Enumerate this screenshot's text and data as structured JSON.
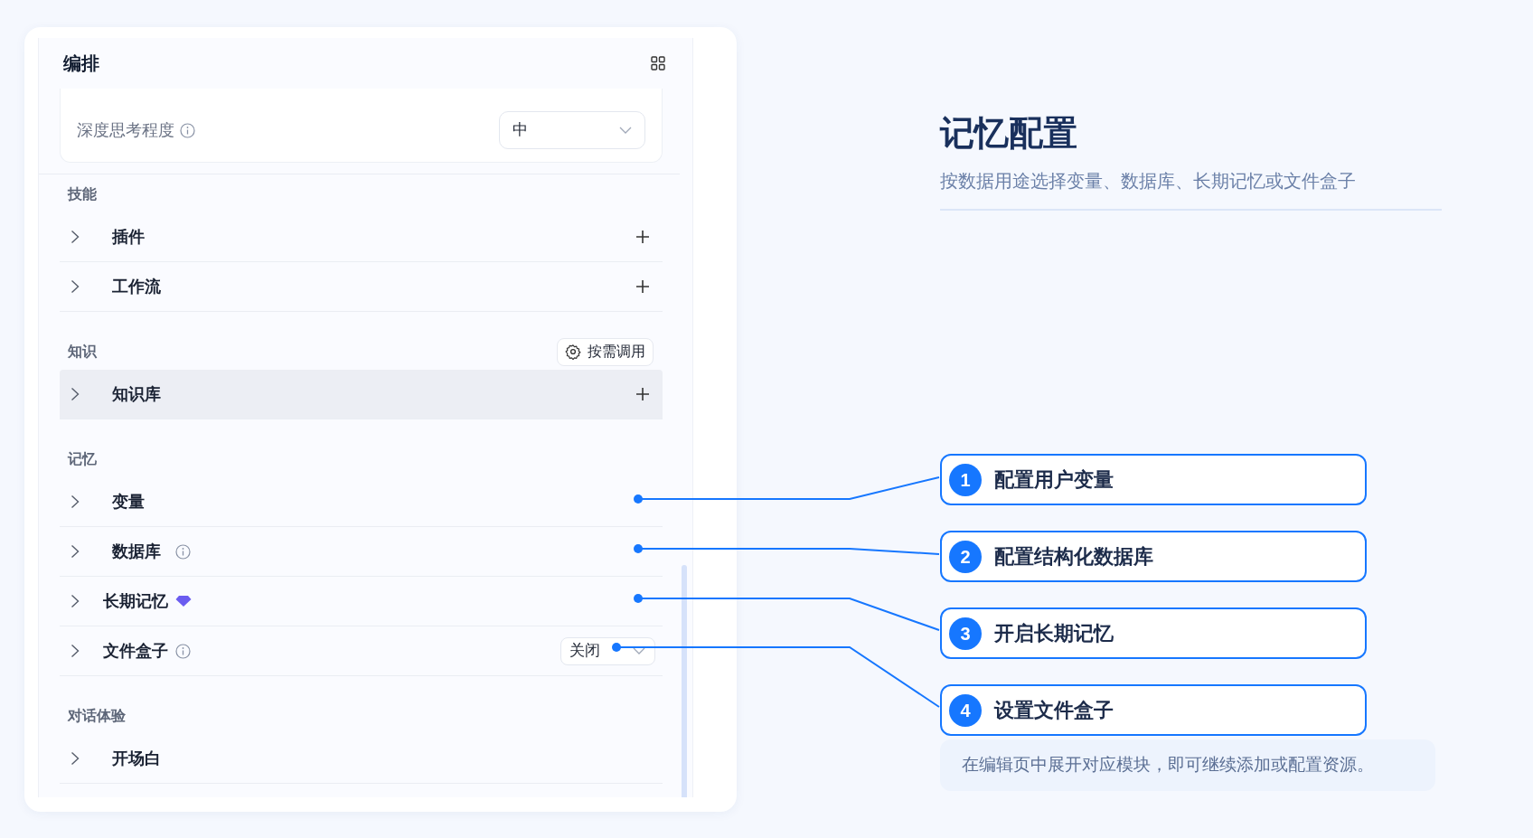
{
  "panel": {
    "title": "编排",
    "settings": [
      {
        "label": "深度思考程度",
        "info": true,
        "value": "中"
      }
    ],
    "sections": [
      {
        "heading": "技能",
        "items": [
          {
            "label": "插件",
            "kind": "add",
            "highlighted": false
          },
          {
            "label": "工作流",
            "kind": "add",
            "highlighted": false
          }
        ]
      },
      {
        "heading": "知识",
        "action": "按需调用",
        "items": [
          {
            "label": "知识库",
            "kind": "add",
            "highlighted": true
          }
        ]
      },
      {
        "heading": "记忆",
        "items": [
          {
            "label": "变量",
            "kind": "plain",
            "highlighted": false
          },
          {
            "label": "数据库",
            "kind": "plain",
            "info": true,
            "highlighted": false
          },
          {
            "label": "长期记忆",
            "kind": "plain",
            "premium": true,
            "highlighted": false
          },
          {
            "label": "文件盒子",
            "kind": "select",
            "value": "关闭",
            "info": true,
            "highlighted": false
          }
        ]
      },
      {
        "heading": "对话体验",
        "items": [
          {
            "label": "开场白",
            "kind": "plain",
            "highlighted": false
          }
        ]
      }
    ]
  },
  "guide": {
    "title": "记忆配置",
    "subtitle": "按数据用途选择变量、数据库、长期记忆或文件盒子",
    "steps": [
      {
        "number": "1",
        "text": "配置用户变量"
      },
      {
        "number": "2",
        "text": "配置结构化数据库"
      },
      {
        "number": "3",
        "text": "开启长期记忆"
      },
      {
        "number": "4",
        "text": "设置文件盒子"
      }
    ],
    "note": "在编辑页中展开对应模块，即可继续添加或配置资源。"
  }
}
